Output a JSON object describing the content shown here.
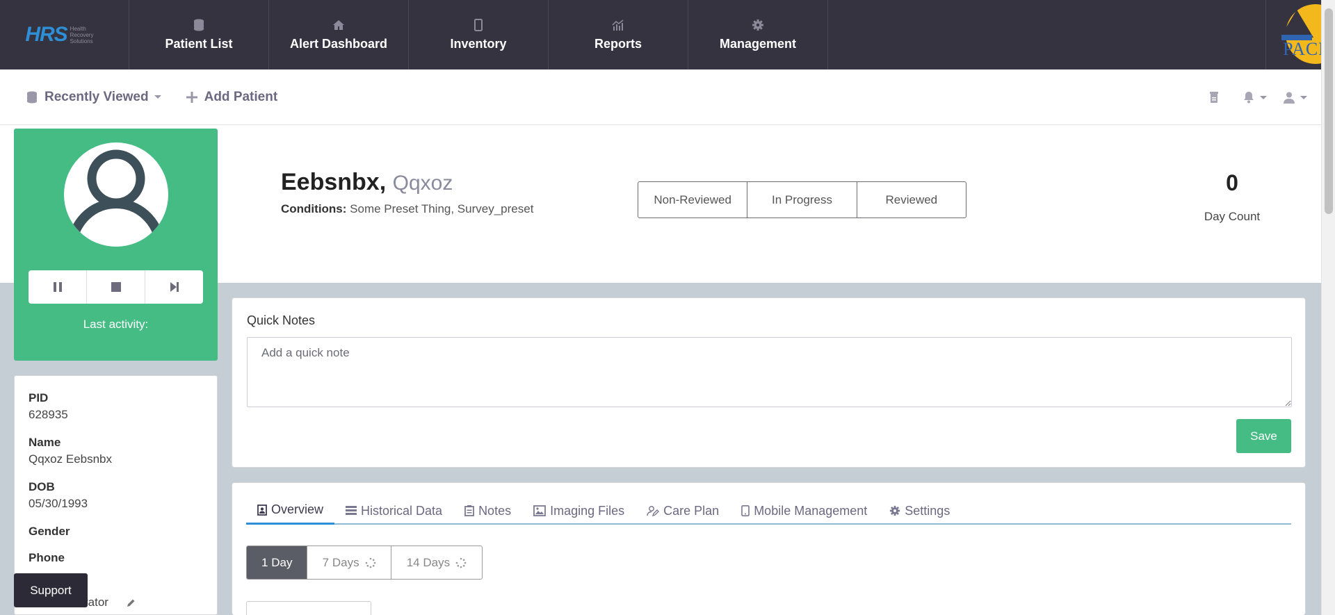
{
  "brand": {
    "logo": "HRS",
    "subtitle": "Health Recovery Solutions"
  },
  "nav": {
    "items": [
      {
        "label": "Patient List",
        "icon": "database-icon"
      },
      {
        "label": "Alert Dashboard",
        "icon": "home-icon"
      },
      {
        "label": "Inventory",
        "icon": "tablet-icon"
      },
      {
        "label": "Reports",
        "icon": "chart-icon"
      },
      {
        "label": "Management",
        "icon": "gear-icon"
      }
    ],
    "partner_logo_text": "PACE"
  },
  "subbar": {
    "recently_viewed": "Recently Viewed",
    "add_patient": "Add Patient"
  },
  "patient": {
    "last_name": "Eebsnbx,",
    "first_name": "Qqxoz",
    "conditions_label": "Conditions:",
    "conditions": "Some Preset Thing, Survey_preset",
    "last_activity": "Last activity:",
    "status_buttons": [
      "Non-Reviewed",
      "In Progress",
      "Reviewed"
    ],
    "day_count": "0",
    "day_count_label": "Day Count"
  },
  "info": {
    "pid_label": "PID",
    "pid": "628935",
    "name_label": "Name",
    "name": "Qqxoz Eebsnbx",
    "dob_label": "DOB",
    "dob": "05/30/1993",
    "gender_label": "Gender",
    "phone_label": "Phone",
    "coordinator_partial": "rator"
  },
  "quick_notes": {
    "title": "Quick Notes",
    "placeholder": "Add a quick note",
    "save": "Save"
  },
  "tabs": [
    {
      "label": "Overview",
      "icon": "clipboard-user-icon",
      "active": true
    },
    {
      "label": "Historical Data",
      "icon": "list-icon",
      "active": false
    },
    {
      "label": "Notes",
      "icon": "notes-icon",
      "active": false
    },
    {
      "label": "Imaging Files",
      "icon": "image-icon",
      "active": false
    },
    {
      "label": "Care Plan",
      "icon": "user-edit-icon",
      "active": false
    },
    {
      "label": "Mobile Management",
      "icon": "mobile-icon",
      "active": false
    },
    {
      "label": "Settings",
      "icon": "gear-icon",
      "active": false
    }
  ],
  "ranges": [
    {
      "label": "1 Day",
      "active": true
    },
    {
      "label": "7 Days",
      "active": false,
      "loading": true
    },
    {
      "label": "14 Days",
      "active": false,
      "loading": true
    }
  ],
  "support": "Support",
  "colors": {
    "nav_bg": "#35333f",
    "accent_green": "#46bc85",
    "brand_blue": "#2e8fd6",
    "panel_gray": "#c5ced4"
  }
}
